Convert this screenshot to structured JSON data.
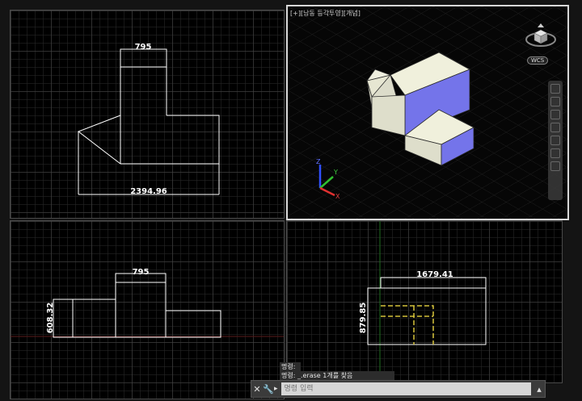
{
  "viewports": {
    "top_left": {
      "dim_top": "795",
      "dim_bottom": "2394.96"
    },
    "top_right": {
      "label": "[+][남동 등각투영][개념]",
      "wcs": "WCS",
      "axis_x": "X",
      "axis_y": "Y",
      "axis_z": "Z"
    },
    "bottom_left": {
      "dim_top": "795",
      "dim_side": "608.32"
    },
    "bottom_right": {
      "dim_top": "1679.41",
      "dim_side": "879.85"
    }
  },
  "command": {
    "history": [
      "명령:",
      "명령:  _.erase 1개를 찾음"
    ],
    "placeholder": "명령 입력",
    "close_icon": "close-icon",
    "wrench_icon": "wrench-icon"
  },
  "colors": {
    "face_light": "#e9e9d5",
    "face_blue": "#7070e8",
    "hidden_line": "#d6c23a",
    "wcs_x": "#e03030",
    "wcs_y": "#30c030",
    "wcs_z": "#3050ff"
  }
}
